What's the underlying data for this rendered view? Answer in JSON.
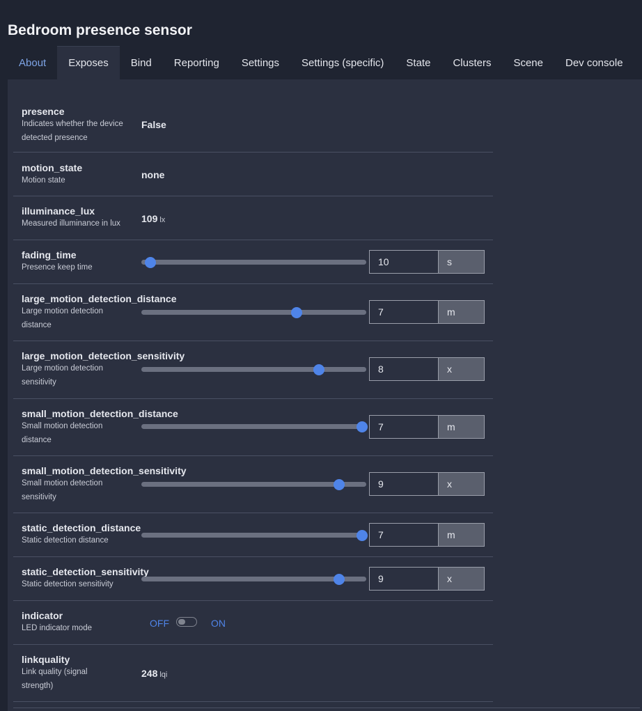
{
  "header": {
    "title": "Bedroom presence sensor"
  },
  "tabs": [
    {
      "label": "About"
    },
    {
      "label": "Exposes"
    },
    {
      "label": "Bind"
    },
    {
      "label": "Reporting"
    },
    {
      "label": "Settings"
    },
    {
      "label": "Settings (specific)"
    },
    {
      "label": "State"
    },
    {
      "label": "Clusters"
    },
    {
      "label": "Scene"
    },
    {
      "label": "Dev console"
    }
  ],
  "active_tab": "Exposes",
  "colors": {
    "accent": "#4f84e8",
    "background": "#1f2431",
    "panel": "#2b3040"
  },
  "exposes": {
    "presence": {
      "name": "presence",
      "desc": "Indicates whether the device detected presence",
      "value": "False"
    },
    "motion_state": {
      "name": "motion_state",
      "desc": "Motion state",
      "value": "none"
    },
    "illuminance_lux": {
      "name": "illuminance_lux",
      "desc": "Measured illuminance in lux",
      "value": "109",
      "unit": "lx"
    },
    "fading_time": {
      "name": "fading_time",
      "desc": "Presence keep time",
      "value": "10",
      "unit": "s",
      "level": 0.04
    },
    "large_motion_detection_distance": {
      "name": "large_motion_detection_distance",
      "desc": "Large motion detection distance",
      "value": "7",
      "unit": "m",
      "level": 0.69
    },
    "large_motion_detection_sensitivity": {
      "name": "large_motion_detection_sensitivity",
      "desc": "Large motion detection sensitivity",
      "value": "8",
      "unit": "x",
      "level": 0.79
    },
    "small_motion_detection_distance": {
      "name": "small_motion_detection_distance",
      "desc": "Small motion detection distance",
      "value": "7",
      "unit": "m",
      "level": 0.98
    },
    "small_motion_detection_sensitivity": {
      "name": "small_motion_detection_sensitivity",
      "desc": "Small motion detection sensitivity",
      "value": "9",
      "unit": "x",
      "level": 0.88
    },
    "static_detection_distance": {
      "name": "static_detection_distance",
      "desc": "Static detection distance",
      "value": "7",
      "unit": "m",
      "level": 0.98
    },
    "static_detection_sensitivity": {
      "name": "static_detection_sensitivity",
      "desc": "Static detection sensitivity",
      "value": "9",
      "unit": "x",
      "level": 0.88
    },
    "indicator": {
      "name": "indicator",
      "desc": "LED indicator mode",
      "off_label": "OFF",
      "on_label": "ON",
      "state": "OFF"
    },
    "linkquality": {
      "name": "linkquality",
      "desc": "Link quality (signal strength)",
      "value": "248",
      "unit": "lqi"
    }
  }
}
